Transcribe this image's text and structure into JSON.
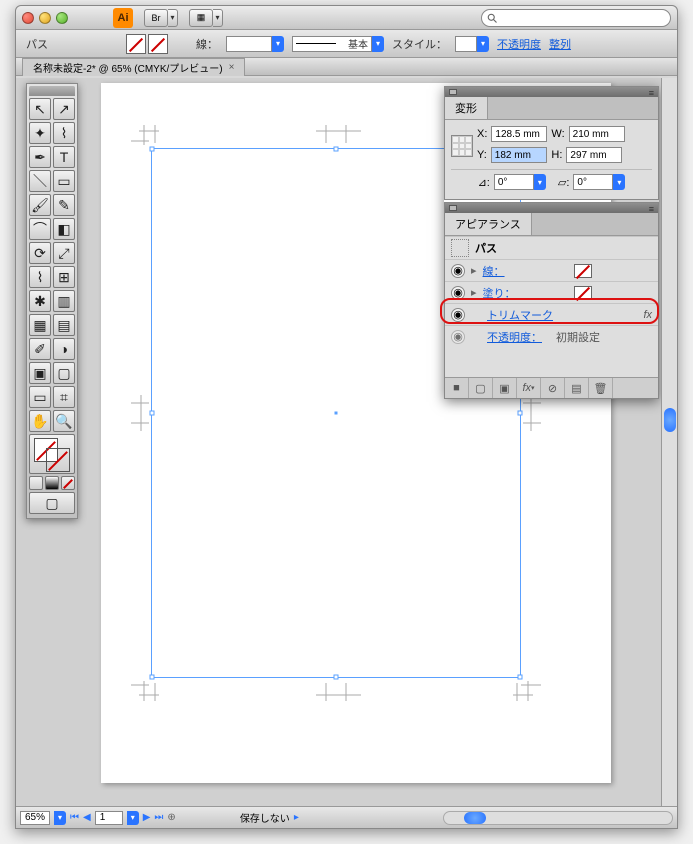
{
  "titlebar": {
    "app_abbr": "Ai",
    "br_label": "Br"
  },
  "optbar": {
    "label": "パス",
    "stroke_label": "線：",
    "style_label": "スタイル：",
    "preset_label": "基本",
    "opacity_label": "不透明度",
    "align_label": "整列"
  },
  "tab": {
    "title": "名称未設定-2* @ 65% (CMYK/プレビュー)"
  },
  "transform": {
    "title": "変形",
    "x_label": "X:",
    "x_value": "128.5 mm",
    "y_label": "Y:",
    "y_value": "182 mm",
    "w_label": "W:",
    "w_value": "210 mm",
    "h_label": "H:",
    "h_value": "297 mm",
    "angle1": "0°",
    "angle2": "0°"
  },
  "appearance": {
    "title": "アピアランス",
    "obj_label": "パス",
    "stroke_label": "線：",
    "fill_label": "塗り：",
    "trim_label": "トリムマーク",
    "fx_label": "fx",
    "opacity_label": "不透明度：",
    "opacity_value": "初期設定"
  },
  "status": {
    "zoom": "65%",
    "page": "1",
    "msg": "保存しない"
  }
}
